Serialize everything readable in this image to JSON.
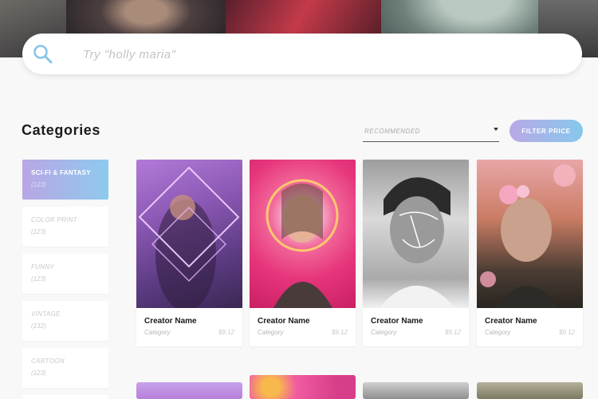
{
  "search": {
    "placeholder": "Try \"holly maria\""
  },
  "section": {
    "title": "Categories"
  },
  "sort": {
    "selected": "RECOMMENDED"
  },
  "filter": {
    "label": "FILTER PRICE"
  },
  "categories": [
    {
      "name": "SCI-FI & FANTASY",
      "count": "(123)",
      "active": true
    },
    {
      "name": "COLOR PRINT",
      "count": "(123)",
      "active": false
    },
    {
      "name": "FUNNY",
      "count": "(123)",
      "active": false
    },
    {
      "name": "VINTAGE",
      "count": "(132)",
      "active": false
    },
    {
      "name": "CARTOON",
      "count": "(123)",
      "active": false
    }
  ],
  "cards": [
    {
      "creator": "Creator Name",
      "category": "Category",
      "price": "$9.12"
    },
    {
      "creator": "Creator Name",
      "category": "Category",
      "price": "$9.12"
    },
    {
      "creator": "Creator Name",
      "category": "Category",
      "price": "$9.12"
    },
    {
      "creator": "Creator Name",
      "category": "Category",
      "price": "$9.12"
    }
  ],
  "colors": {
    "accent_start": "#b9a9e6",
    "accent_end": "#86c8ec",
    "search_icon": "#86c5ea"
  },
  "icons": {
    "search": "search-icon",
    "dropdown": "chevron-down-icon"
  }
}
